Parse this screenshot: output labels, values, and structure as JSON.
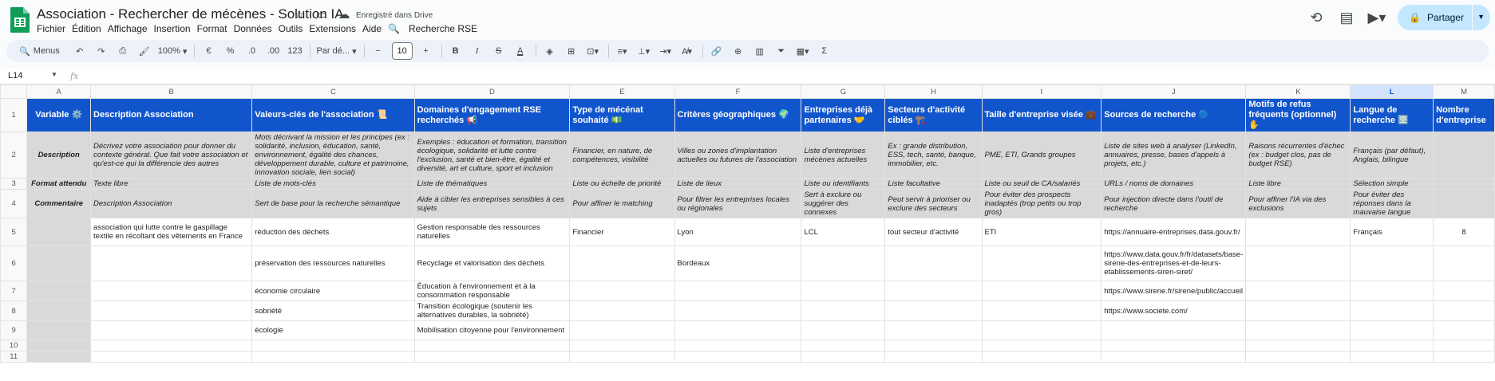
{
  "app": {
    "title": "Association - Rechercher de mécènes - Solution IA",
    "saved_status": "Enregistré dans Drive",
    "share_label": "Partager"
  },
  "menu": {
    "items": [
      "Fichier",
      "Édition",
      "Affichage",
      "Insertion",
      "Format",
      "Données",
      "Outils",
      "Extensions",
      "Aide"
    ],
    "rse_label": "Recherche RSE"
  },
  "toolbar": {
    "menus_label": "Menus",
    "zoom": "100%",
    "currency": "€",
    "percent": "%",
    "dec_less": ".0",
    "dec_more": ".00",
    "number_format": "123",
    "font": "Par dé...",
    "font_size": "10",
    "minus": "−",
    "plus": "+",
    "bold": "B",
    "italic": "I",
    "strike": "S",
    "textcolor": "A",
    "sigma": "Σ"
  },
  "formula_bar": {
    "cell_ref": "L14",
    "fx": "fx"
  },
  "grid": {
    "columns": [
      "A",
      "B",
      "C",
      "D",
      "E",
      "F",
      "G",
      "H",
      "I",
      "J",
      "K",
      "L",
      "M"
    ],
    "selected_column": "L",
    "rows": [
      {
        "num": "1",
        "cells": [
          "Variable ⚙️",
          "Description Association",
          "Valeurs-clés de l'association 📜",
          "Domaines d'engagement RSE recherchés 📢",
          "Type de mécénat souhaité 💵",
          "Critères géographiques 🌍",
          "Entreprises déjà partenaires 🤝",
          "Secteurs d'activité ciblés 🏗️",
          "Taille d'entreprise visée 💼",
          "Sources de recherche 🔵",
          "Motifs de refus fréquents (optionnel) ✋",
          "Langue de recherche 🈳",
          "Nombre d'entreprise"
        ]
      },
      {
        "num": "2",
        "cells": [
          "Description",
          "Décrivez votre association pour donner du contexte général. Que fait votre association et qu'est-ce qui la différencie des autres",
          "Mots décrivant la mission et les principes (ex : solidarité, inclusion, éducation, santé, environnement, égalité des chances, développement durable, culture et patrimoine, innovation sociale, lien social)",
          "Exemples : éducation et formation, transition écologique, solidarité et lutte contre l'exclusion, santé et bien-être, égalité et diversité, art et culture, sport et inclusion",
          "Financier, en nature, de compétences, visibilité",
          "Villes ou zones d'implantation actuelles ou futures de l'association",
          "Liste d'entreprises mécènes actuelles",
          "Ex : grande distribution, ESS, tech, santé, banque, immobilier, etc.",
          "PME, ETI, Grands groupes",
          "Liste de sites web à analyser (LinkedIn, annuaires, presse, bases d'appels à projets, etc.)",
          "Raisons récurrentes d'échec (ex : budget clos, pas de budget RSE)",
          "Français (par défaut), Anglais, bilingue",
          ""
        ]
      },
      {
        "num": "3",
        "cells": [
          "Format attendu",
          "Texte libre",
          "Liste de mots-clés",
          "Liste de thématiques",
          "Liste ou échelle de priorité",
          "Liste de lieux",
          "Liste ou identifiants",
          "Liste facultative",
          "Liste ou seuil de CA/salariés",
          "URLs / noms de domaines",
          "Liste libre",
          "Sélection simple",
          ""
        ]
      },
      {
        "num": "4",
        "cells": [
          "Commentaire",
          "Description Association",
          "Sert de base pour la recherche sémantique",
          "Aide à cibler les entreprises sensibles à ces sujets",
          "Pour affiner le matching",
          "Pour filtrer les entreprises locales ou régionales",
          "Sert à exclure ou suggérer des connexes",
          "Peut servir à prioriser ou exclure des secteurs",
          "Pour éviter des prospects inadaptés (trop petits ou trop gros)",
          "Pour injection directe dans l'outil de recherche",
          "Pour affiner l'IA via des exclusions",
          "Pour éviter des réponses dans la mauvaise langue",
          ""
        ]
      },
      {
        "num": "5",
        "cells": [
          "",
          "association qui lutte contre le gaspillage textile en récoltant des vêtements en France",
          "réduction des déchets",
          "Gestion responsable des ressources naturelles",
          "Financier",
          "Lyon",
          "LCL",
          "tout secteur d'activité",
          "ETI",
          "https://annuaire-entreprises.data.gouv.fr/",
          "",
          "Français",
          "8"
        ]
      },
      {
        "num": "6",
        "cells": [
          "",
          "",
          "préservation des ressources naturelles",
          "Recyclage et valorisation des déchets",
          "",
          "Bordeaux",
          "",
          "",
          "",
          "https://www.data.gouv.fr/fr/datasets/base-sirene-des-entreprises-et-de-leurs-etablissements-siren-siret/",
          "",
          "",
          ""
        ]
      },
      {
        "num": "7",
        "cells": [
          "",
          "",
          "économie circulaire",
          "Éducation à l'environnement et à la consommation responsable",
          "",
          "",
          "",
          "",
          "",
          "https://www.sirene.fr/sirene/public/accueil",
          "",
          "",
          ""
        ]
      },
      {
        "num": "8",
        "cells": [
          "",
          "",
          "sobriété",
          "Transition écologique (soutenir les alternatives durables, la sobriété)",
          "",
          "",
          "",
          "",
          "",
          "https://www.societe.com/",
          "",
          "",
          ""
        ]
      },
      {
        "num": "9",
        "cells": [
          "",
          "",
          "écologie",
          "Mobilisation citoyenne pour l'environnement",
          "",
          "",
          "",
          "",
          "",
          "",
          "",
          "",
          ""
        ]
      },
      {
        "num": "10",
        "cells": [
          "",
          "",
          "",
          "",
          "",
          "",
          "",
          "",
          "",
          "",
          "",
          "",
          ""
        ]
      },
      {
        "num": "11",
        "cells": [
          "",
          "",
          "",
          "",
          "",
          "",
          "",
          "",
          "",
          "",
          "",
          "",
          ""
        ]
      }
    ]
  }
}
